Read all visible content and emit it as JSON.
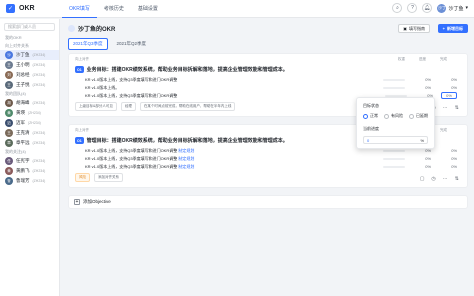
{
  "topbar": {
    "logo_text": "OKR",
    "nav": [
      "OKR填写",
      "考核历史",
      "基础设置"
    ],
    "user_name": "沙丁鱼",
    "user_avatar_text": "沙丁",
    "colors": {
      "accent": "#3370ff"
    }
  },
  "sidebar": {
    "search_placeholder": "搜索部门或人员",
    "section_mine": "我的OKR",
    "section_superior": "向上对齐关系",
    "people": [
      {
        "avatar": "沙",
        "name": "沙丁鱼",
        "sub": "(ZH234)",
        "selected": true
      },
      {
        "avatar": "王",
        "name": "王小明",
        "sub": "(ZH234)"
      },
      {
        "avatar": "刘",
        "name": "刘总经",
        "sub": "(ZH234)"
      },
      {
        "avatar": "王",
        "name": "王子悦",
        "sub": "(ZH234)"
      }
    ],
    "section_team": "我的团队(4)",
    "team": [
      {
        "avatar": "胡",
        "name": "胡海峰",
        "sub": "(ZH234)"
      },
      {
        "avatar": "黄",
        "name": "黄瑛",
        "sub": "(ZH234)"
      },
      {
        "avatar": "迈",
        "name": "迈军",
        "sub": "(ZH234)"
      },
      {
        "avatar": "王",
        "name": "王克清",
        "sub": "(ZH234)"
      },
      {
        "avatar": "章",
        "name": "章平远",
        "sub": "(ZH234)"
      }
    ],
    "section_other": "我的关注(4)",
    "other": [
      {
        "avatar": "任",
        "name": "任宪宇",
        "sub": "(ZH234)"
      },
      {
        "avatar": "黄",
        "name": "黄鹏飞",
        "sub": "(ZH234)"
      },
      {
        "avatar": "鲁",
        "name": "鲁瑞芳",
        "sub": "(ZH234)"
      }
    ]
  },
  "main": {
    "title": "沙丁鱼的OKR",
    "guide_button": "填写指南",
    "add_button": "新增目标",
    "tabs": [
      "2021年Q3季度",
      "2021年Q2季度"
    ],
    "col_labels": [
      "权重",
      "进度",
      "完成"
    ],
    "objectives": [
      {
        "head": "向上对齐",
        "badge": "O1",
        "chip": "O",
        "title": "业务目标：搭建OKR绩效系统，帮助业务目标拆解和落地，提高企业管理效能和管理成本。",
        "krs": [
          {
            "text": "KR v1.0版本上线，支持Q3季度填写和进门OKR调整",
            "link": "",
            "weight": "0%",
            "progress": "0%"
          },
          {
            "text": "KR v1.0版本上线。",
            "link": "",
            "weight": "0%",
            "progress": "0%"
          },
          {
            "text": "KR v1.0版本上线，支持Q3季度填写和进门OKR调整",
            "link": "",
            "weight": "0%",
            "progress": "0%"
          }
        ],
        "footer": [
          "上级目标&部分人可见",
          "经理",
          "在某个时间点前完成，帮助在线用户，帮助在半年内上线"
        ]
      },
      {
        "head": "向上对齐",
        "badge": "O1",
        "chip": "O",
        "title": "管理目标：搭建OKR绩效系统，帮助业务目标拆解和落地，提高企业管理效能和管理成本。",
        "krs": [
          {
            "text": "KR v1.0版本上线，支持Q3季度填写和进门OKR调整",
            "link": "制定规划",
            "weight": "0%",
            "progress": "0%"
          },
          {
            "text": "KR v1.0版本上线，支持Q3季度填写和进门OKR调整",
            "link": "制定规划",
            "weight": "0%",
            "progress": "0%"
          },
          {
            "text": "KR v1.0版本上线，支持Q3季度填写和进门OKR调整",
            "link": "制定规划",
            "weight": "0%",
            "progress": "0%"
          }
        ],
        "footer": [
          "风险",
          "添加对齐关系"
        ]
      }
    ],
    "add_objective": "添加Objective"
  },
  "popover": {
    "status_label": "目标状态",
    "options": [
      "正常",
      "有风险",
      "已延期"
    ],
    "selected": "正常",
    "progress_label": "当前进度",
    "progress_value": "0",
    "progress_unit": "%"
  }
}
